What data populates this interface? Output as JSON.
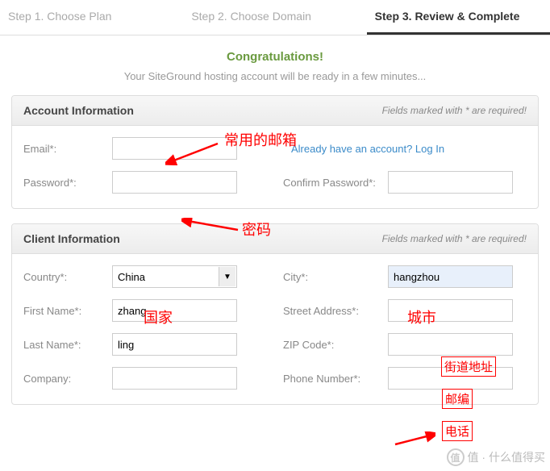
{
  "steps": {
    "s1": "Step 1. Choose Plan",
    "s2": "Step 2. Choose Domain",
    "s3": "Step 3. Review & Complete"
  },
  "congrats": "Congratulations!",
  "subtext": "Your SiteGround hosting account will be ready in a few minutes...",
  "required_note": "Fields marked with * are required!",
  "account": {
    "title": "Account Information",
    "email_label": "Email*:",
    "email_value": "",
    "login_link": "Already have an account? Log In",
    "password_label": "Password*:",
    "password_value": "",
    "confirm_label": "Confirm Password*:",
    "confirm_value": ""
  },
  "client": {
    "title": "Client Information",
    "country_label": "Country*:",
    "country_value": "China",
    "city_label": "City*:",
    "city_value": "hangzhou",
    "first_label": "First Name*:",
    "first_value": "zhang",
    "street_label": "Street Address*:",
    "street_value": "",
    "last_label": "Last Name*:",
    "last_value": "ling",
    "zip_label": "ZIP Code*:",
    "zip_value": "",
    "company_label": "Company:",
    "company_value": "",
    "phone_label": "Phone Number*:",
    "phone_value": ""
  },
  "annotations": {
    "email": "常用的邮箱",
    "password": "密码",
    "country": "国家",
    "city": "城市",
    "street": "街道地址",
    "zip": "邮编",
    "phone": "电话"
  },
  "watermark": "值 · 什么值得买"
}
